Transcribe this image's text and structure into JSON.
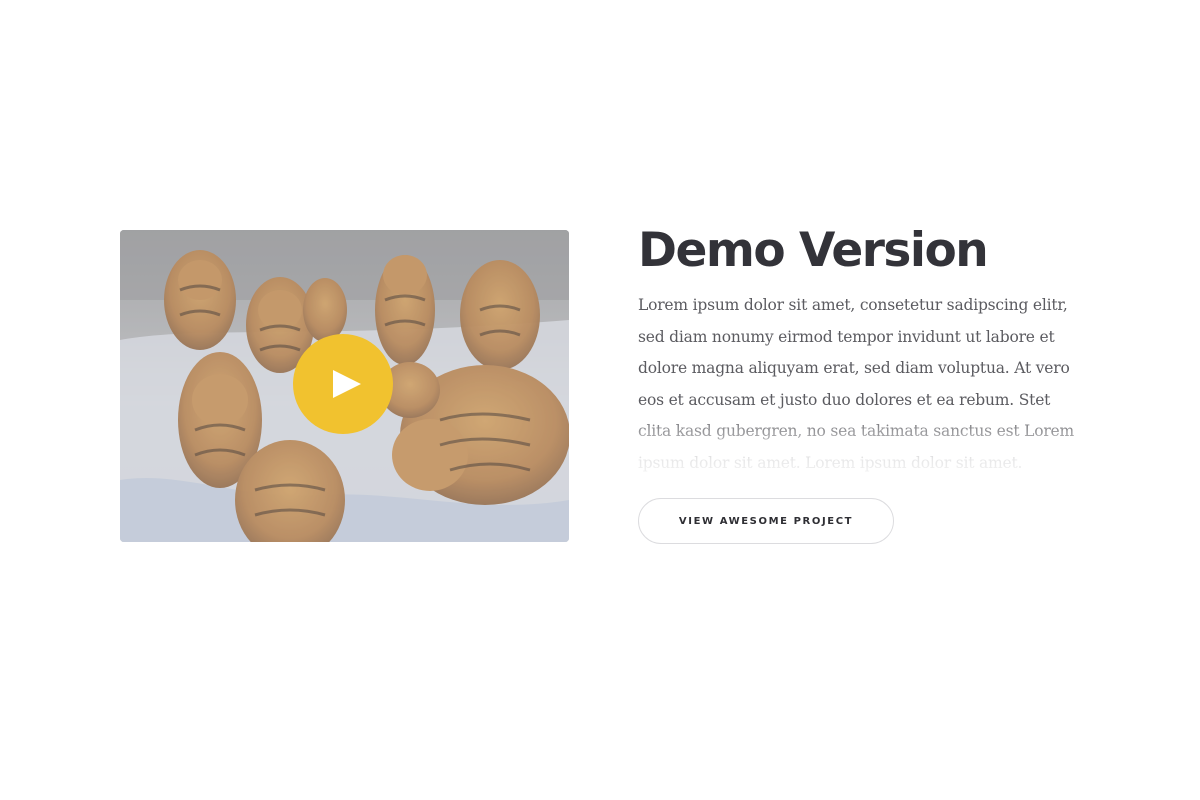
{
  "video": {
    "thumbnail_subject": "tigers running through snow",
    "play_button_color": "#f1c22f",
    "play_icon": "play-icon"
  },
  "content": {
    "title": "Demo Version",
    "description": "Lorem ipsum dolor sit amet, consetetur sadipscing elitr, sed diam nonumy eirmod tempor invidunt ut labore et dolore magna aliquyam erat, sed diam voluptua. At vero eos et accusam et justo duo dolores et ea rebum. Stet clita kasd gubergren, no sea takimata sanctus est Lorem ipsum dolor sit amet. Lorem ipsum dolor sit amet.",
    "cta_label": "VIEW AWESOME PROJECT"
  },
  "colors": {
    "title": "#333339",
    "text": "#5b5b60",
    "accent": "#f1c22f"
  }
}
